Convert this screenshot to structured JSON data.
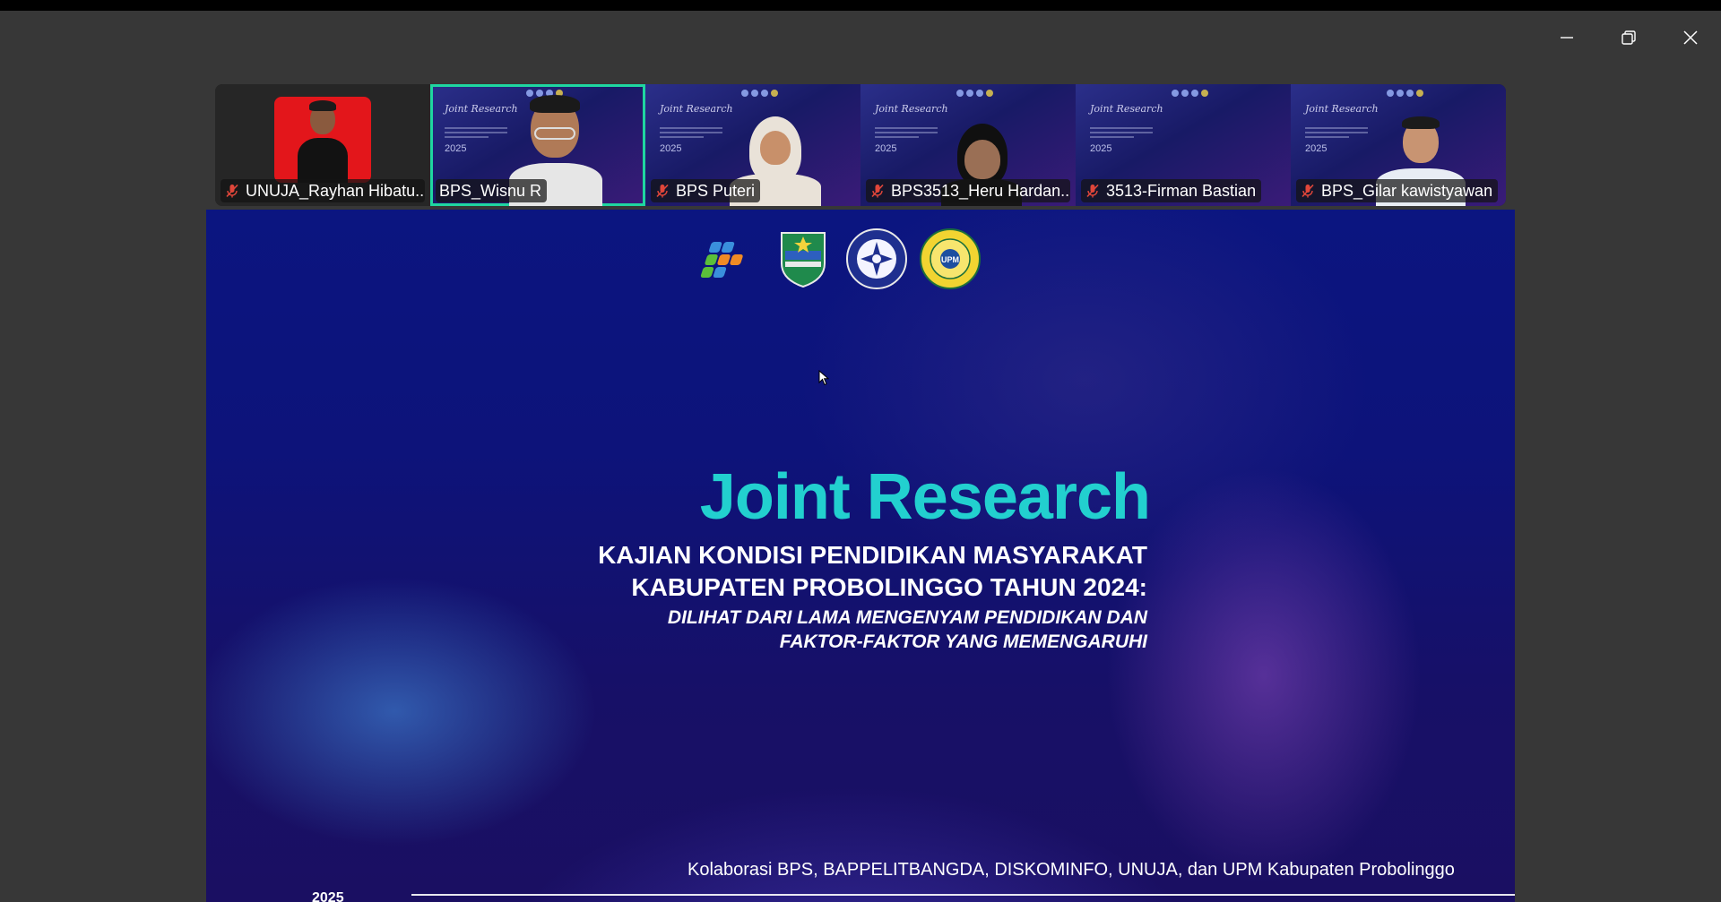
{
  "window": {
    "controls": {
      "minimize_icon": "minimize-icon",
      "restore_icon": "restore-icon",
      "close_icon": "close-icon"
    }
  },
  "participants": [
    {
      "name": "UNUJA_Rayhan Hibatu...",
      "muted": true,
      "active_speaker": false
    },
    {
      "name": "BPS_Wisnu R",
      "muted": false,
      "active_speaker": true
    },
    {
      "name": "BPS Puteri",
      "muted": true,
      "active_speaker": false
    },
    {
      "name": "BPS3513_Heru Hardan...",
      "muted": true,
      "active_speaker": false
    },
    {
      "name": "3513-Firman Bastian",
      "muted": true,
      "active_speaker": false
    },
    {
      "name": "BPS_Gilar kawistyawan",
      "muted": true,
      "active_speaker": false
    }
  ],
  "thumbnail_slide": {
    "title_line1": "Joint Research",
    "year": "2025"
  },
  "slide": {
    "title": "Joint Research",
    "heading_line1": "KAJIAN KONDISI PENDIDIKAN MASYARAKAT",
    "heading_line2": "KABUPATEN PROBOLINGGO TAHUN 2024:",
    "sub_line1": "DILIHAT DARI LAMA MENGENYAM PENDIDIKAN DAN",
    "sub_line2": "FAKTOR-FAKTOR YANG MEMENGARUHI",
    "footer": "Kolaborasi BPS, BAPPELITBANGDA, DISKOMINFO, UNUJA, dan UPM Kabupaten Probolinggo",
    "year": "2025",
    "logos": [
      "bps-logo",
      "probolinggo-regency-crest",
      "unuja-seal",
      "upm-seal"
    ]
  },
  "colors": {
    "accent_teal": "#22d0cf",
    "active_speaker_border": "#1fd6a0",
    "muted_icon": "#e0463a",
    "slide_bg": "#0d137a",
    "app_bg": "#373737"
  }
}
